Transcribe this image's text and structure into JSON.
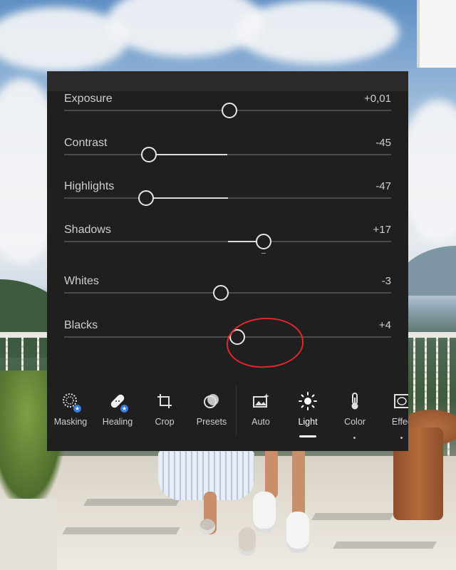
{
  "sliders": [
    {
      "label": "Exposure",
      "value": "+0,01",
      "level": 0.505
    },
    {
      "label": "Contrast",
      "value": "-45",
      "level": 0.26
    },
    {
      "label": "Highlights",
      "value": "-47",
      "level": 0.25
    },
    {
      "label": "Shadows",
      "value": "+17",
      "level": 0.61
    },
    {
      "label": "Whites",
      "value": "-3",
      "level": 0.48
    },
    {
      "label": "Blacks",
      "value": "+4",
      "level": 0.53
    }
  ],
  "toolbar": {
    "masking_label": "Masking",
    "healing_label": "Healing",
    "crop_label": "Crop",
    "presets_label": "Presets",
    "auto_label": "Auto",
    "light_label": "Light",
    "color_label": "Color",
    "effects_label": "Effec"
  },
  "active_tool": "Light",
  "colors": {
    "panel": "#1f1f1f",
    "highlight_ring": "#e3262d",
    "badge": "#2f7de0"
  }
}
